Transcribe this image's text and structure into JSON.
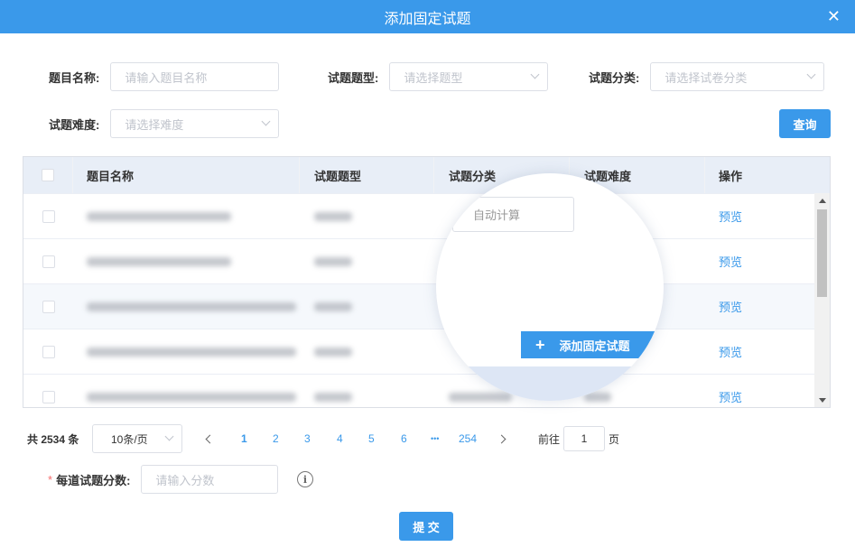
{
  "dialog": {
    "title": "添加固定试题",
    "close_icon": "close-icon"
  },
  "filters": {
    "name_label": "题目名称:",
    "name_placeholder": "请输入题目名称",
    "type_label": "试题题型:",
    "type_placeholder": "请选择题型",
    "category_label": "试题分类:",
    "category_placeholder": "请选择试卷分类",
    "difficulty_label": "试题难度:",
    "difficulty_placeholder": "请选择难度",
    "query_button": "查询"
  },
  "table": {
    "columns": [
      "题目名称",
      "试题题型",
      "试题分类",
      "试题难度",
      "操作"
    ],
    "rows": [
      {
        "action": "预览"
      },
      {
        "action": "预览"
      },
      {
        "action": "预览"
      },
      {
        "action": "预览"
      },
      {
        "action": "预览"
      }
    ]
  },
  "magnifier": {
    "input_text": "自动计算",
    "button_label": "添加固定试题"
  },
  "pagination": {
    "total": "共 2534 条",
    "page_size": "10条/页",
    "pages": [
      "1",
      "2",
      "3",
      "4",
      "5",
      "6",
      "•••",
      "254"
    ],
    "current_page": "1",
    "goto_prefix": "前往",
    "goto_value": "1",
    "goto_suffix": "页"
  },
  "score": {
    "required_mark": "*",
    "label": "每道试题分数:",
    "placeholder": "请输入分数",
    "info_icon": "i"
  },
  "submit_button": "提 交",
  "colors": {
    "primary": "#3a99ea",
    "header_bg": "#3a99ea",
    "table_header_bg": "#e8eef7"
  }
}
